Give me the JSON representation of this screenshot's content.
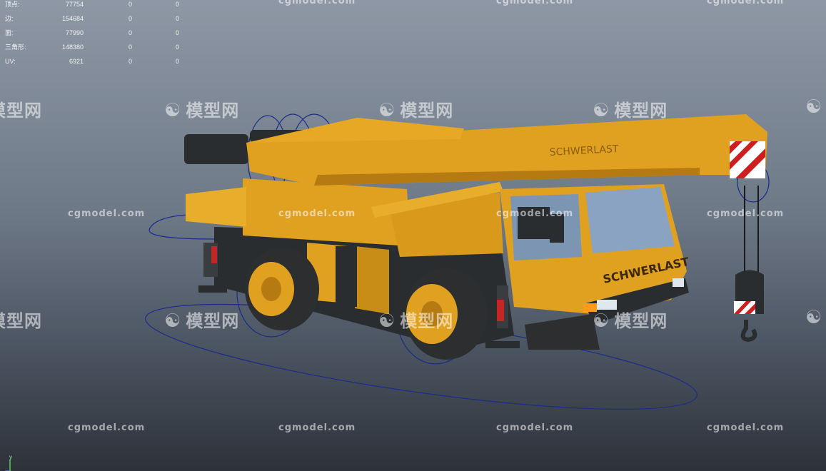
{
  "hud": {
    "rows": [
      {
        "label": "顶点:",
        "v1": "77754",
        "v2": "0",
        "v3": "0"
      },
      {
        "label": "边:",
        "v1": "154684",
        "v2": "0",
        "v3": "0"
      },
      {
        "label": "面:",
        "v1": "77990",
        "v2": "0",
        "v3": "0"
      },
      {
        "label": "三角形:",
        "v1": "148380",
        "v2": "0",
        "v3": "0"
      },
      {
        "label": "UV:",
        "v1": "6921",
        "v2": "0",
        "v3": "0"
      }
    ]
  },
  "model": {
    "boom_text": "SCHWERLAST",
    "cab_text": "SCHWERLAST",
    "body_color": "#e0a020",
    "shadow_color": "#b57a12",
    "dark_color": "#2a2d2f",
    "rig_color": "#1c2a8c"
  },
  "watermark": {
    "url_text": "cgmodel.com",
    "logo_text": "模型网"
  },
  "axis": {
    "label": "y"
  }
}
